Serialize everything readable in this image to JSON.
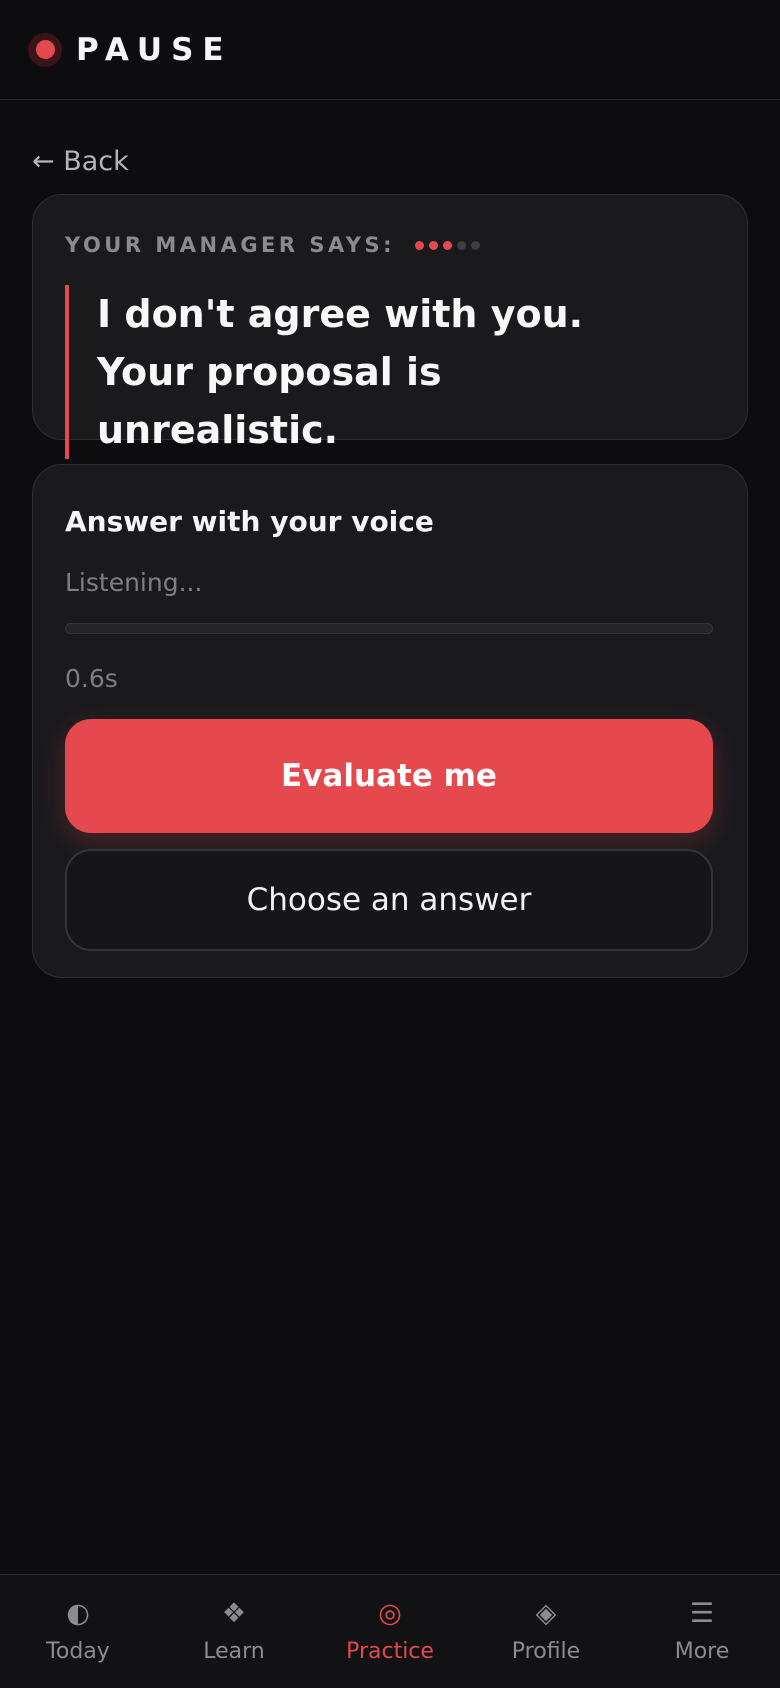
{
  "header": {
    "brand": "PAUSE"
  },
  "back_label": "← Back",
  "prompt": {
    "label": "YOUR MANAGER SAYS:",
    "dots_total": 5,
    "dots_active": 3,
    "quote": "I don't agree with you. Your proposal is unrealistic."
  },
  "voice": {
    "title": "Answer with your voice",
    "status": "Listening...",
    "progress": 0,
    "elapsed": "0.6s",
    "primary_label": "Evaluate me",
    "secondary_label": "Choose an answer"
  },
  "nav": [
    {
      "icon": "◐",
      "label": "Today",
      "icon_name": "half-circle-icon",
      "active": false
    },
    {
      "icon": "❖",
      "label": "Learn",
      "icon_name": "diamond-cluster-icon",
      "active": false
    },
    {
      "icon": "◎",
      "label": "Practice",
      "icon_name": "target-icon",
      "active": true
    },
    {
      "icon": "◈",
      "label": "Profile",
      "icon_name": "diamond-icon",
      "active": false
    },
    {
      "icon": "☰",
      "label": "More",
      "icon_name": "menu-icon",
      "active": false
    }
  ],
  "colors": {
    "accent": "#e5484d",
    "background": "#0d0d0f",
    "card": "#1a1a1d"
  }
}
